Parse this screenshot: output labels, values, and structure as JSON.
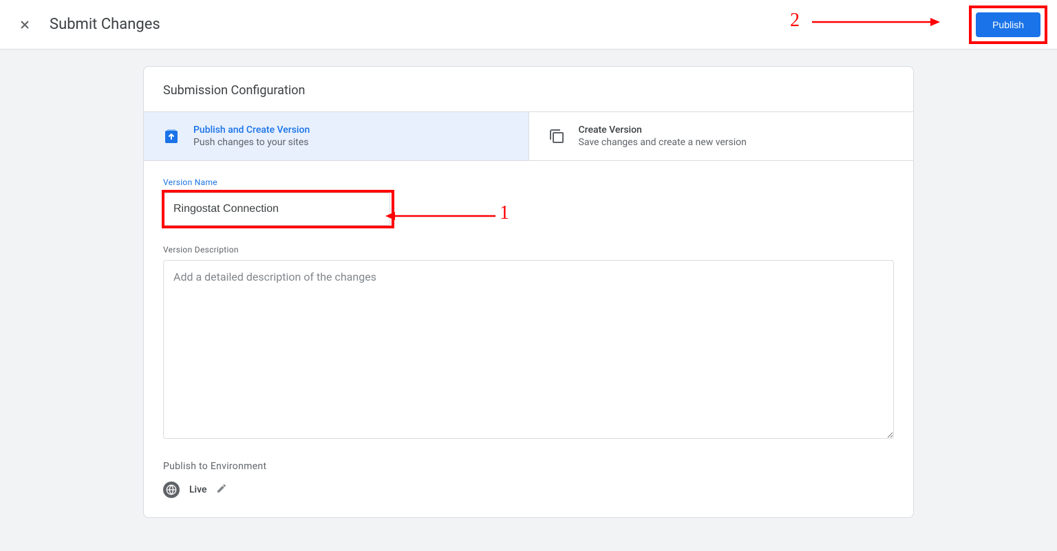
{
  "header": {
    "title": "Submit Changes",
    "publish_label": "Publish"
  },
  "card": {
    "title": "Submission Configuration",
    "options": [
      {
        "title": "Publish and Create Version",
        "subtitle": "Push changes to your sites"
      },
      {
        "title": "Create Version",
        "subtitle": "Save changes and create a new version"
      }
    ],
    "version_name_label": "Version Name",
    "version_name_value": "Ringostat Connection",
    "version_desc_label": "Version Description",
    "version_desc_placeholder": "Add a detailed description of the changes",
    "publish_env_label": "Publish to Environment",
    "env_name": "Live"
  },
  "annotations": {
    "num1": "1",
    "num2": "2"
  }
}
